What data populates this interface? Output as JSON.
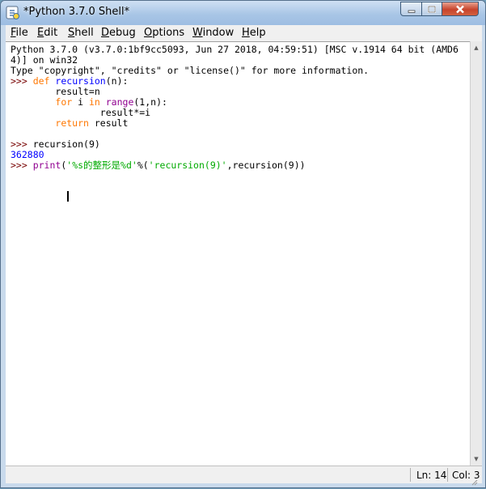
{
  "window": {
    "title": "*Python 3.7.0 Shell*"
  },
  "menu": {
    "items": [
      "File",
      "Edit",
      "Shell",
      "Debug",
      "Options",
      "Window",
      "Help"
    ]
  },
  "shell": {
    "banner1": "Python 3.7.0 (v3.7.0:1bf9cc5093, Jun 27 2018, 04:59:51) [MSC v.1914 64 bit (AMD6",
    "banner2": "4)] on win32",
    "banner3": "Type \"copyright\", \"credits\" or \"license()\" for more information.",
    "prompt": ">>> ",
    "def_kw": "def",
    "def_name": "recursion",
    "def_rest": "(n):",
    "line_result": "        result=n",
    "for_kw": "for",
    "for_mid": " i ",
    "in_kw": "in",
    "range_fn": "range",
    "for_rest": "(1,n):",
    "line_mul": "                result*=i",
    "return_kw": "return",
    "return_rest": " result",
    "call1": "recursion(9)",
    "output1": "362880",
    "print_fn": "print",
    "print_open": "(",
    "fmt_str": "'%s的整形是%d'",
    "print_mid": "%(",
    "arg_str": "'recursion(9)'",
    "print_rest": ",recursion(9))"
  },
  "status": {
    "line": "Ln: 14",
    "col": "Col: 3"
  },
  "colors": {
    "keyword": "#ff7700",
    "definition": "#0000ff",
    "builtin": "#900090",
    "string": "#00aa00",
    "prompt": "#770000",
    "output": "#0000ff"
  },
  "icons": [
    "python-idle-icon",
    "minimize-icon",
    "maximize-icon",
    "close-icon",
    "scroll-up-arrow-icon",
    "scroll-down-arrow-icon",
    "size-grip-icon"
  ]
}
